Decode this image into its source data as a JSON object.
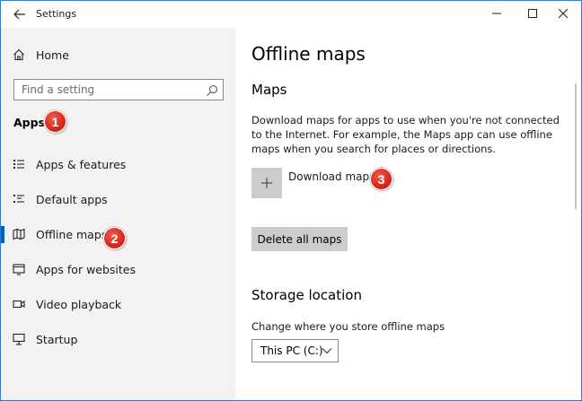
{
  "window": {
    "title": "Settings",
    "controls": {
      "minimize": "minimize",
      "maximize": "maximize",
      "close": "close"
    }
  },
  "sidebar": {
    "home_label": "Home",
    "search": {
      "placeholder": "Find a setting"
    },
    "section_heading": "Apps",
    "items": [
      {
        "label": "Apps & features",
        "icon": "apps-features-icon",
        "selected": false
      },
      {
        "label": "Default apps",
        "icon": "default-apps-icon",
        "selected": false
      },
      {
        "label": "Offline maps",
        "icon": "offline-maps-icon",
        "selected": true
      },
      {
        "label": "Apps for websites",
        "icon": "apps-websites-icon",
        "selected": false
      },
      {
        "label": "Video playback",
        "icon": "video-playback-icon",
        "selected": false
      },
      {
        "label": "Startup",
        "icon": "startup-icon",
        "selected": false
      }
    ]
  },
  "main": {
    "title": "Offline maps",
    "maps_heading": "Maps",
    "description": "Download maps for apps to use when you're not connected to the Internet. For example, the Maps app can use offline maps when you search for places or directions.",
    "download_label": "Download maps",
    "delete_label": "Delete all maps",
    "storage_heading": "Storage location",
    "storage_description": "Change where you store offline maps",
    "storage_value": "This PC (C:)"
  },
  "badges": [
    "1",
    "2",
    "3"
  ],
  "colors": {
    "accent": "#0063b1",
    "sidebar_bg": "#f2f2f2",
    "button_bg": "#cccccc",
    "badge_red": "#d9261c",
    "window_border": "#2f7bd6"
  }
}
